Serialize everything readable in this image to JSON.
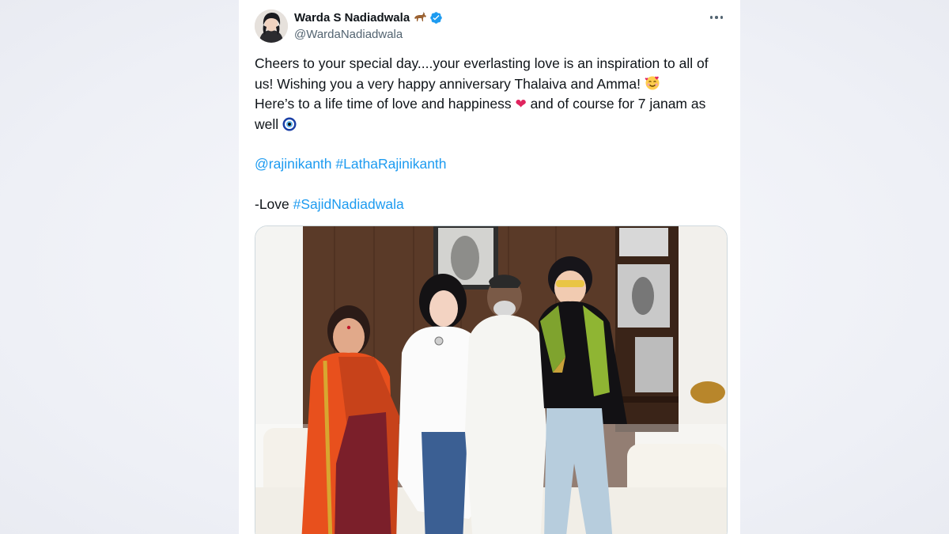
{
  "tweet": {
    "author": {
      "display_name": "Warda S Nadiadwala",
      "name_emoji": "horse",
      "verified": true,
      "handle": "@WardaNadiadwala"
    },
    "more_icon": "more-horizontal-icon",
    "body": {
      "line1": "Cheers to your special day....your everlasting love is an inspiration to all of us! Wishing you a very happy anniversary Thalaiva and Amma! ",
      "line1_emoji": "smiling-face-with-hearts",
      "line2": "Here’s to a life time of love and happiness ",
      "heart_emoji": "❤",
      "line2b": " and of course for 7 janam as well ",
      "line2_emoji": "nazar-amulet",
      "mention": "@rajinikanth",
      "hashtag1": "#LathaRajinikanth",
      "love_prefix": "-Love ",
      "hashtag2": "#SajidNadiadwala"
    },
    "media": {
      "type": "photo"
    }
  },
  "colors": {
    "link": "#1d9bf0",
    "verified": "#1d9bf0",
    "text": "#0f1419",
    "secondary": "#536471"
  }
}
